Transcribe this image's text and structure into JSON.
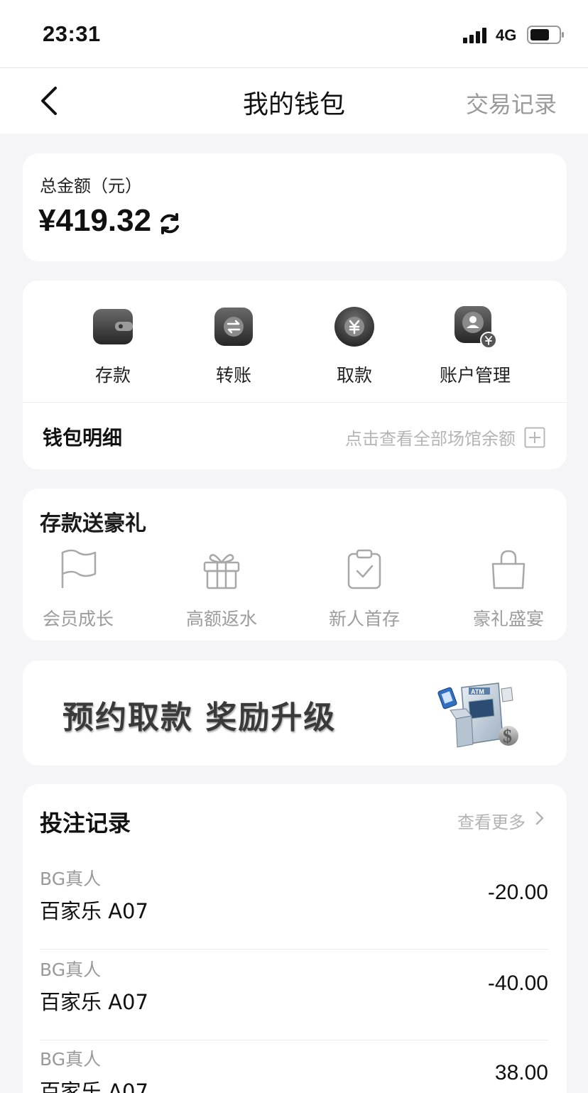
{
  "status_bar": {
    "time": "23:31",
    "network": "4G",
    "signal_bars": 4,
    "battery_level": 0.7
  },
  "header": {
    "title": "我的钱包",
    "right_link": "交易记录"
  },
  "balance": {
    "label": "总金额（元）",
    "amount": "¥419.32"
  },
  "actions": [
    {
      "label": "存款",
      "icon": "wallet-icon"
    },
    {
      "label": "转账",
      "icon": "transfer-icon"
    },
    {
      "label": "取款",
      "icon": "yuan-coin-icon"
    },
    {
      "label": "账户管理",
      "icon": "account-manage-icon"
    }
  ],
  "wallet_detail": {
    "title": "钱包明细",
    "hint": "点击查看全部场馆余额"
  },
  "promo": {
    "title": "存款送豪礼",
    "items": [
      {
        "label": "会员成长",
        "icon": "flag-icon"
      },
      {
        "label": "高额返水",
        "icon": "gift-icon"
      },
      {
        "label": "新人首存",
        "icon": "clipboard-check-icon"
      },
      {
        "label": "豪礼盛宴",
        "icon": "shopping-bag-icon"
      }
    ]
  },
  "banner": {
    "text": "预约取款 奖励升级",
    "art": "atm-money-icon"
  },
  "bets": {
    "title": "投注记录",
    "more": "查看更多",
    "rows": [
      {
        "provider": "BG真人",
        "game": "百家乐 A07",
        "amount": "-20.00"
      },
      {
        "provider": "BG真人",
        "game": "百家乐 A07",
        "amount": "-40.00"
      },
      {
        "provider": "BG真人",
        "game": "百家乐 A07",
        "amount": "38.00"
      }
    ]
  }
}
